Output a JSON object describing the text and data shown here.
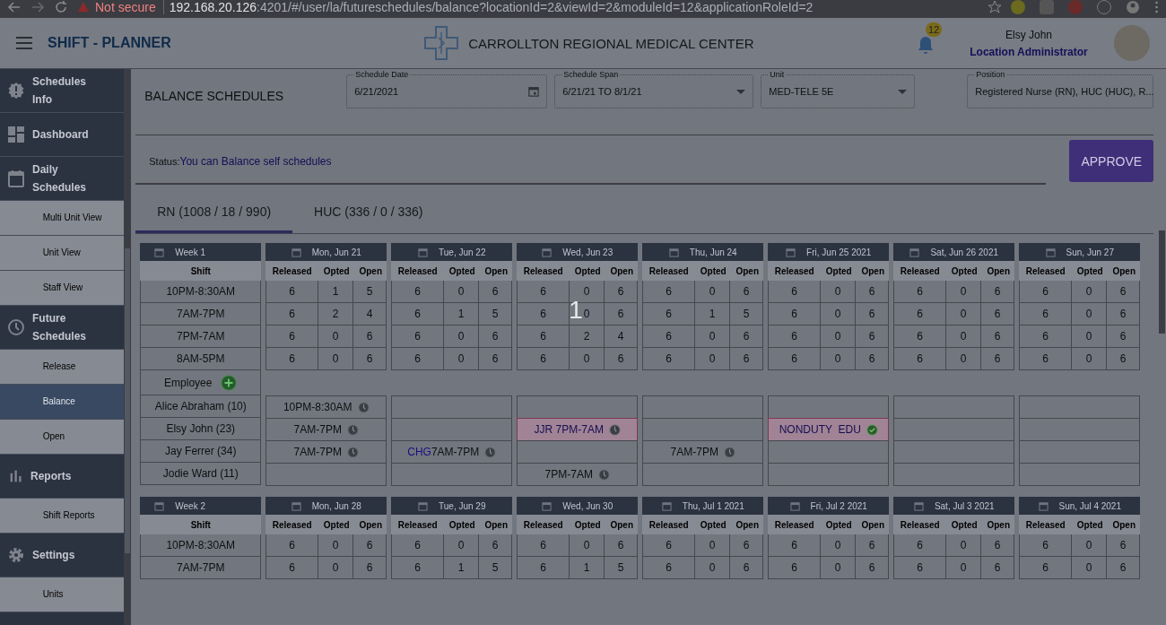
{
  "browser": {
    "security": "Not secure",
    "url_host": "192.168.20.126",
    "url_path": ":4201/#/user/la/futureschedules/balance?locationId=2&viewId=2&moduleId=12&applicationRoleId=2"
  },
  "header": {
    "app_title": "SHIFT - PLANNER",
    "organization": "CARROLLTON REGIONAL MEDICAL CENTER",
    "notification_count": "12",
    "user_name": "Elsy John",
    "user_role": "Location Administrator"
  },
  "sidebar": [
    {
      "kind": "badge",
      "label": "Schedules Info",
      "selected": false
    },
    {
      "kind": "dashboard",
      "label": "Dashboard",
      "selected": false
    },
    {
      "kind": "calendar",
      "label": "Daily Schedules",
      "selected": false
    },
    {
      "kind": "sub",
      "label": "Multi Unit View",
      "selected": false
    },
    {
      "kind": "sub",
      "label": "Unit View",
      "selected": false
    },
    {
      "kind": "sub",
      "label": "Staff View",
      "selected": false
    },
    {
      "kind": "clock",
      "label": "Future Schedules",
      "selected": false
    },
    {
      "kind": "sub",
      "label": "Release",
      "selected": false
    },
    {
      "kind": "sub",
      "label": "Balance",
      "selected": true
    },
    {
      "kind": "sub",
      "label": "Open",
      "selected": false
    },
    {
      "kind": "chart",
      "label": "Reports",
      "selected": false
    },
    {
      "kind": "sub",
      "label": "Shift Reports",
      "selected": false
    },
    {
      "kind": "gear",
      "label": "Settings",
      "selected": false
    },
    {
      "kind": "sub",
      "label": "Units",
      "selected": false
    }
  ],
  "page_title": "BALANCE SCHEDULES",
  "filters": [
    {
      "kind": "date",
      "label": "Schedule Date",
      "value": "6/21/2021"
    },
    {
      "kind": "select",
      "label": "Schedule Span",
      "value": "6/21/21 TO 8/1/21"
    },
    {
      "kind": "select",
      "label": "Unit",
      "value": "MED-TELE 5E"
    },
    {
      "kind": "select",
      "label": "Position",
      "value": "Registered Nurse (RN), HUC (HUC), R..."
    }
  ],
  "status": {
    "label": "Status:",
    "message": "You can Balance self schedules"
  },
  "approve_button": "APPROVE",
  "tabs": [
    {
      "label": "RN (1008 / 18 / 990)",
      "selected": true
    },
    {
      "label": "HUC (336 / 0 / 336)",
      "selected": false
    }
  ],
  "overlay_number": "1",
  "weeks": [
    {
      "label": "Week 1",
      "shift_header": "Shift",
      "shifts": [
        "10PM-8:30AM",
        "7AM-7PM",
        "7PM-7AM",
        "8AM-5PM"
      ],
      "employee_header": "Employee",
      "employees": [
        "Alice Abraham (10)",
        "Elsy John (23)",
        "Jay Ferrer (34)",
        "Jodie Ward (11)"
      ],
      "days": [
        {
          "label": "Mon, Jun 21",
          "columns": [
            "Released",
            "Opted",
            "Open"
          ],
          "rows": [
            [
              "6",
              "1",
              "5"
            ],
            [
              "6",
              "2",
              "4"
            ],
            [
              "6",
              "0",
              "6"
            ],
            [
              "6",
              "0",
              "6"
            ]
          ],
          "cells": [
            {
              "kind": "shift",
              "text": "10PM-8:30AM"
            },
            {
              "kind": "shift",
              "text": "7AM-7PM"
            },
            {
              "kind": "shift",
              "text": "7AM-7PM"
            },
            {
              "kind": "empty"
            }
          ]
        },
        {
          "label": "Tue, Jun 22",
          "columns": [
            "Released",
            "Opted",
            "Open"
          ],
          "rows": [
            [
              "6",
              "0",
              "6"
            ],
            [
              "6",
              "1",
              "5"
            ],
            [
              "6",
              "0",
              "6"
            ],
            [
              "6",
              "0",
              "6"
            ]
          ],
          "cells": [
            {
              "kind": "empty"
            },
            {
              "kind": "empty"
            },
            {
              "kind": "shift",
              "tag": "CHG",
              "text": "7AM-7PM"
            },
            {
              "kind": "empty"
            }
          ]
        },
        {
          "label": "Wed, Jun 23",
          "columns": [
            "Released",
            "Opted",
            "Open"
          ],
          "rows": [
            [
              "6",
              "0",
              "6"
            ],
            [
              "6",
              "0",
              "6"
            ],
            [
              "6",
              "2",
              "4"
            ],
            [
              "6",
              "0",
              "6"
            ]
          ],
          "cells": [
            {
              "kind": "empty"
            },
            {
              "kind": "leave",
              "text": "JJR 7PM-7AM"
            },
            {
              "kind": "empty"
            },
            {
              "kind": "shift",
              "text": "7PM-7AM"
            }
          ]
        },
        {
          "label": "Thu, Jun 24",
          "columns": [
            "Released",
            "Opted",
            "Open"
          ],
          "rows": [
            [
              "6",
              "0",
              "6"
            ],
            [
              "6",
              "1",
              "5"
            ],
            [
              "6",
              "0",
              "6"
            ],
            [
              "6",
              "0",
              "6"
            ]
          ],
          "cells": [
            {
              "kind": "empty"
            },
            {
              "kind": "empty"
            },
            {
              "kind": "shift",
              "text": "7AM-7PM"
            },
            {
              "kind": "empty"
            }
          ]
        },
        {
          "label": "Fri, Jun 25 2021",
          "columns": [
            "Released",
            "Opted",
            "Open"
          ],
          "rows": [
            [
              "6",
              "0",
              "6"
            ],
            [
              "6",
              "0",
              "6"
            ],
            [
              "6",
              "0",
              "6"
            ],
            [
              "6",
              "0",
              "6"
            ]
          ],
          "cells": [
            {
              "kind": "empty"
            },
            {
              "kind": "nonduty",
              "text": "NONDUTY  EDU"
            },
            {
              "kind": "empty"
            },
            {
              "kind": "empty"
            }
          ]
        },
        {
          "label": "Sat, Jun 26 2021",
          "columns": [
            "Released",
            "Opted",
            "Open"
          ],
          "rows": [
            [
              "6",
              "0",
              "6"
            ],
            [
              "6",
              "0",
              "6"
            ],
            [
              "6",
              "0",
              "6"
            ],
            [
              "6",
              "0",
              "6"
            ]
          ],
          "cells": [
            {
              "kind": "empty"
            },
            {
              "kind": "empty"
            },
            {
              "kind": "empty"
            },
            {
              "kind": "empty"
            }
          ]
        },
        {
          "label": "Sun, Jun 27",
          "columns": [
            "Released",
            "Opted",
            "Open"
          ],
          "rows": [
            [
              "6",
              "0",
              "6"
            ],
            [
              "6",
              "0",
              "6"
            ],
            [
              "6",
              "0",
              "6"
            ],
            [
              "6",
              "0",
              "6"
            ]
          ],
          "cells": [
            {
              "kind": "empty"
            },
            {
              "kind": "empty"
            },
            {
              "kind": "empty"
            },
            {
              "kind": "empty"
            }
          ]
        }
      ]
    },
    {
      "label": "Week 2",
      "shift_header": "Shift",
      "shifts": [
        "10PM-8:30AM",
        "7AM-7PM"
      ],
      "days": [
        {
          "label": "Mon, Jun 28",
          "columns": [
            "Released",
            "Opted",
            "Open"
          ],
          "rows": [
            [
              "6",
              "0",
              "6"
            ],
            [
              "6",
              "0",
              "6"
            ]
          ]
        },
        {
          "label": "Tue, Jun 29",
          "columns": [
            "Released",
            "Opted",
            "Open"
          ],
          "rows": [
            [
              "6",
              "0",
              "6"
            ],
            [
              "6",
              "1",
              "5"
            ]
          ]
        },
        {
          "label": "Wed, Jun 30",
          "columns": [
            "Released",
            "Opted",
            "Open"
          ],
          "rows": [
            [
              "6",
              "0",
              "6"
            ],
            [
              "6",
              "1",
              "5"
            ]
          ]
        },
        {
          "label": "Thu, Jul 1 2021",
          "columns": [
            "Released",
            "Opted",
            "Open"
          ],
          "rows": [
            [
              "6",
              "0",
              "6"
            ],
            [
              "6",
              "0",
              "6"
            ]
          ]
        },
        {
          "label": "Fri, Jul 2 2021",
          "columns": [
            "Released",
            "Opted",
            "Open"
          ],
          "rows": [
            [
              "6",
              "0",
              "6"
            ],
            [
              "6",
              "0",
              "6"
            ]
          ]
        },
        {
          "label": "Sat, Jul 3 2021",
          "columns": [
            "Released",
            "Opted",
            "Open"
          ],
          "rows": [
            [
              "6",
              "0",
              "6"
            ],
            [
              "6",
              "0",
              "6"
            ]
          ]
        },
        {
          "label": "Sun, Jul 4 2021",
          "columns": [
            "Released",
            "Opted",
            "Open"
          ],
          "rows": [
            [
              "6",
              "0",
              "6"
            ],
            [
              "6",
              "0",
              "6"
            ]
          ]
        }
      ]
    }
  ]
}
